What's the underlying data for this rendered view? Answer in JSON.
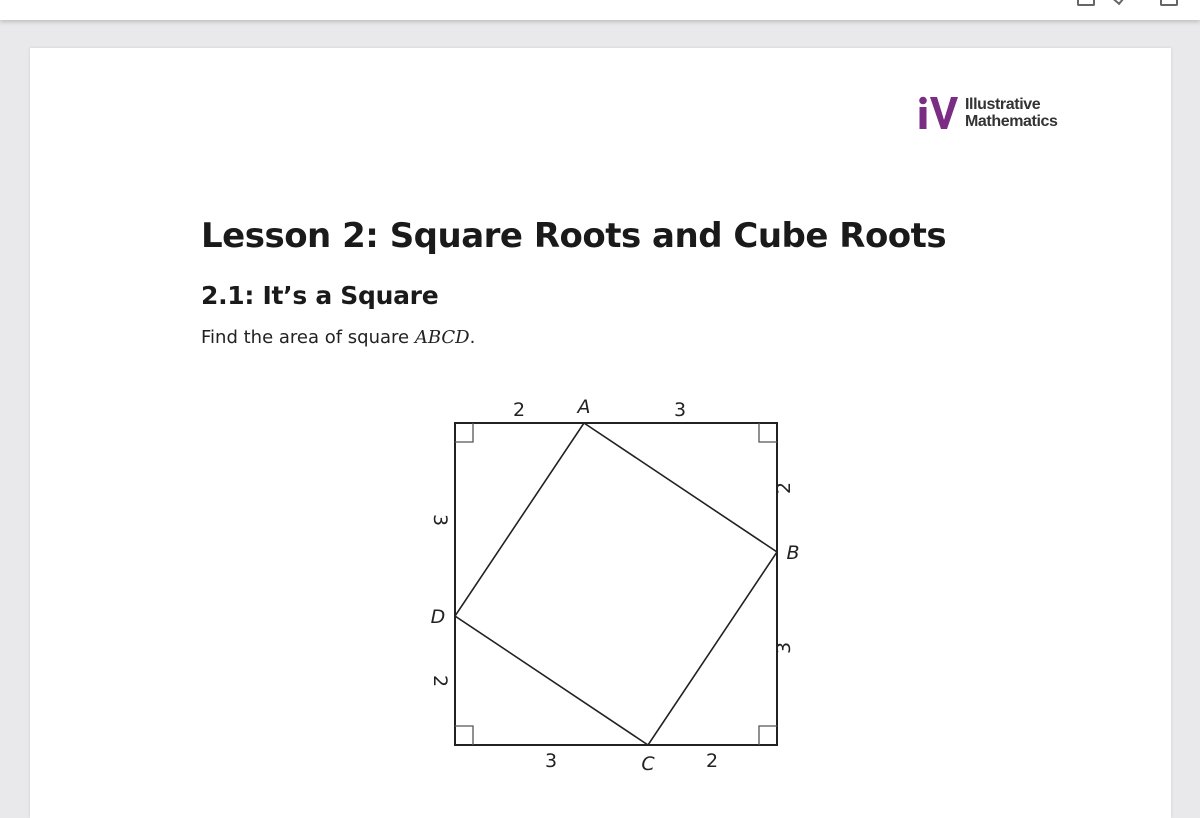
{
  "lesson": {
    "title": "Lesson 2: Square Roots and Cube Roots"
  },
  "activity": {
    "title": "2.1: It’s a Square",
    "prompt_text": "Find the area of square ",
    "prompt_math": "ABCD",
    "prompt_end": "."
  },
  "logo": {
    "line1": "Illustrative",
    "line2": "Mathematics",
    "color": "#7b2c83"
  },
  "figure": {
    "vertices": {
      "A": "A",
      "B": "B",
      "C": "C",
      "D": "D"
    },
    "segment_labels": {
      "top_left": "2",
      "top_right": "3",
      "right_top": "2",
      "right_bottom": "3",
      "bottom_left": "3",
      "bottom_right": "2",
      "left_top": "3",
      "left_bottom": "2"
    }
  }
}
